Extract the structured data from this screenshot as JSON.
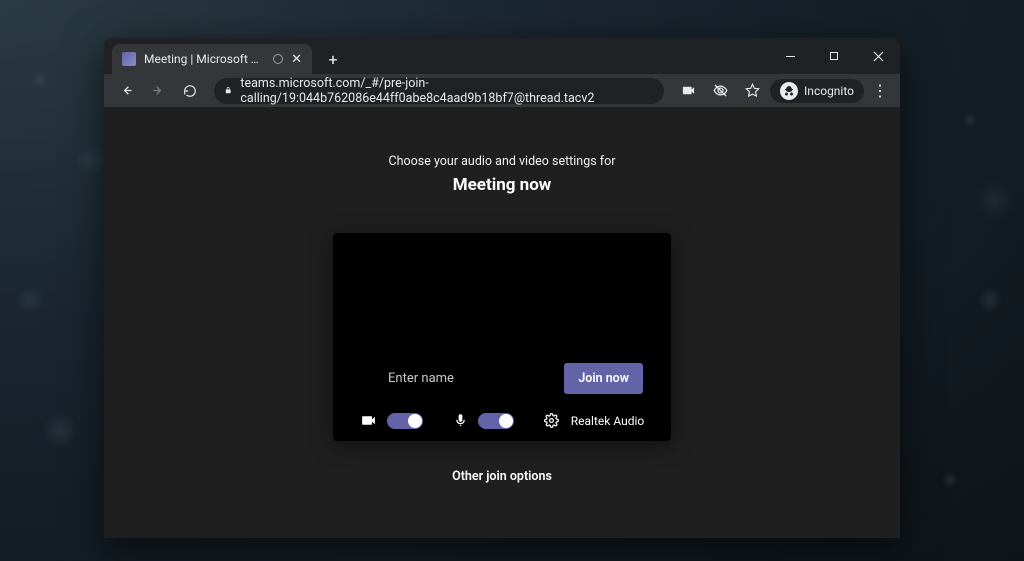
{
  "browser": {
    "tab": {
      "title": "Meeting | Microsoft Teams"
    },
    "url": "teams.microsoft.com/_#/pre-join-calling/19:044b762086e44ff0abe8c4aad9b18bf7@thread.tacv2",
    "incognito_label": "Incognito"
  },
  "page": {
    "pretitle": "Choose your audio and video settings for",
    "meeting_title": "Meeting now",
    "name_placeholder": "Enter name",
    "join_label": "Join now",
    "audio_device": "Realtek Audio",
    "other_options": "Other join options",
    "camera_on": true,
    "mic_on": true
  },
  "colors": {
    "accent": "#6264a7",
    "page_bg": "#1f1f1f"
  }
}
